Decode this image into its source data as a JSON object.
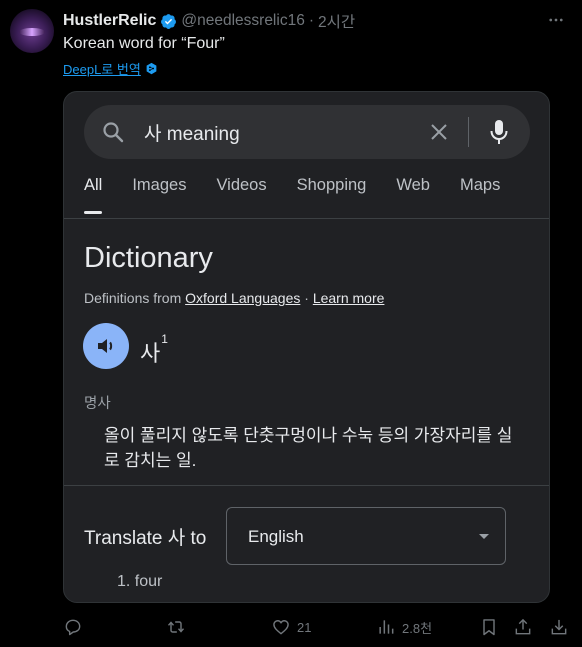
{
  "tweet": {
    "author_name": "HustlerRelic",
    "handle": "@needlessrelic16",
    "separator": "·",
    "time": "2시간",
    "text": "Korean word for “Four”",
    "translate_link": "DeepL로 번역"
  },
  "google": {
    "search_query": "사 meaning",
    "tabs": [
      {
        "label": "All"
      },
      {
        "label": "Images"
      },
      {
        "label": "Videos"
      },
      {
        "label": "Shopping"
      },
      {
        "label": "Web"
      },
      {
        "label": "Maps"
      }
    ],
    "dictionary": {
      "title": "Dictionary",
      "definitions_from": "Definitions from",
      "source": "Oxford Languages",
      "separator": "·",
      "learn_more": "Learn more",
      "headword": "사",
      "superscript": "1",
      "part_of_speech": "명사",
      "definition": "올이 풀리지 않도록 단춧구멍이나 수눅 등의 가장자리를 실로 감치는 일."
    },
    "translate": {
      "label": "Translate 사 to",
      "language": "English",
      "result": "1. four"
    }
  },
  "actions": {
    "replies": "",
    "reposts": "",
    "likes": "21",
    "views": "2.8천"
  },
  "colors": {
    "accent": "#1d9bf0",
    "speaker": "#8ab4f8",
    "background": "#000000",
    "card": "#202124"
  }
}
